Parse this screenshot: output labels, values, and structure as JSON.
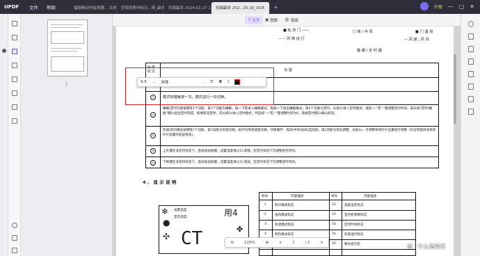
{
  "app": {
    "logo": "UPDF",
    "menu": [
      "文件",
      "帮助"
    ],
    "tabs": [
      "福瑞泰动作监视器... 文档_Copy",
      "空调说明书标记...网_副本_1*",
      "扫描副本 2024-01-27 15:19",
      "扫描副本 202...15.18_OCR"
    ],
    "active_tab_index": 3,
    "upgrade_label": "升级"
  },
  "toolbar": {
    "text_label": "文字",
    "image_label": "图像",
    "link_label": "链接"
  },
  "thumbnail": {
    "page_number": "1"
  },
  "edit_bar": {
    "font_size": "9.5",
    "font_family": "宋体",
    "bold": "B",
    "italic": "I"
  },
  "document": {
    "top_labels": {
      "l1": "■ 检 风 门 ——",
      "l2": "—— 风 扇 运 行",
      "l3": "□ 高 / 中 风",
      "l4": "■ 门 温 增",
      "l5": "— 风 速 , 风 向",
      "l6": "睡 眠 / 定 时 键"
    },
    "table_header": {
      "col1": "按 键 标 识",
      "col2": "功 能"
    },
    "rows": [
      {
        "sym": "◎",
        "text": "模式热键每按一次，模式进行一次切换。"
      },
      {
        "sym": "◎",
        "text": "睡眠/定时功能按键有2个功能：第1个功能为睡眠，按一下就进入睡眠模式，再按一下退出睡眠模式；第2个功能为定时，长按5s进入定时模式，再按\"+\"或\"-\"键调整定时时间，再长按\"定时/睡眠\"键5s退出定时完成，如要取消定时，先长按5s进入定时模式，然后按\"+\"或\"-\"键调整时间为0，再按定时键5s确认取消。"
      },
      {
        "sym": "◎",
        "text": "风速/风向键此按键有2个功能，第1功能为风速切换，执行内风机速度切换，切换循环：高风/中风/低风/自动风。第2功能为风向调整，长按3s，可调整导风叶片位置进行调整（仅对有摆风或导风叶片装置的机型有效）。"
      },
      {
        "sym": "⊕",
        "text": "上升键在非定时状态下，连续按此按键，设置温度将以1C递增。在定时状态下可调整定时时间。"
      },
      {
        "sym": "⊖",
        "text": "下降键在非定时状态下，连续按此按键，设置温度将以1C递减。在定时状态下可调整定时时间。"
      }
    ],
    "section_title": "4 、 显 示 说 明",
    "display": {
      "labels": [
        "设置温度",
        "室内温度"
      ],
      "readout": "CT",
      "mode_text": "用4"
    },
    "spec_table": {
      "headers": [
        "标号",
        "内容描述",
        "标号",
        "内容描述"
      ],
      "rows": [
        [
          "1",
          "制冷模式标志",
          "12",
          "温度设定标志"
        ],
        [
          "2",
          "送风模式标志",
          "13",
          "室内机参数标志"
        ],
        [
          "3",
          "除湿模式标志",
          "14",
          "定时时间标志"
        ],
        [
          "4",
          "制热模式标志",
          "15",
          "风速运行标志"
        ],
        [
          "5",
          "自动模式标志",
          "16",
          "数码显示区"
        ]
      ]
    }
  },
  "zoom": {
    "level": "129%",
    "page": "1",
    "total": "/ 1"
  },
  "watermark": "值 · 什么值得买"
}
